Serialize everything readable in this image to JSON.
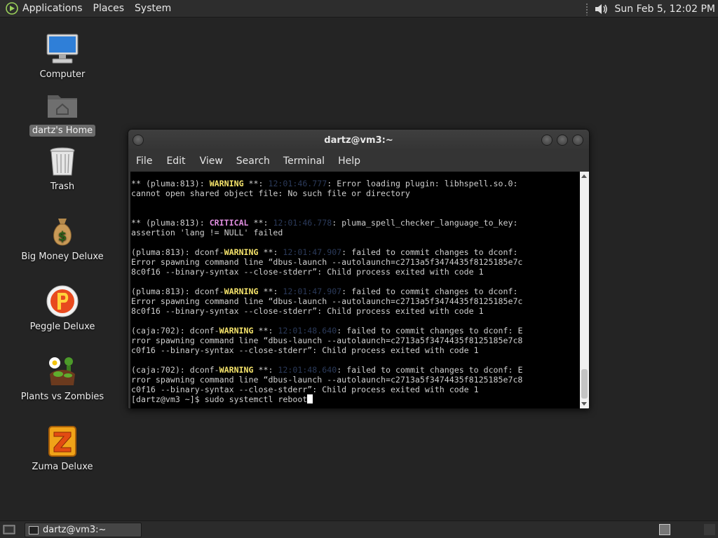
{
  "top_panel": {
    "menus": [
      "Applications",
      "Places",
      "System"
    ],
    "clock": "Sun Feb  5, 12:02 PM",
    "icons": [
      "distro-logo-icon",
      "volume-icon"
    ]
  },
  "desktop": {
    "icons": [
      {
        "label": "Computer",
        "icon": "computer-icon"
      },
      {
        "label": "dartz's Home",
        "icon": "home-folder-icon",
        "selected": true
      },
      {
        "label": "Trash",
        "icon": "trash-icon"
      },
      {
        "label": "Big Money Deluxe",
        "icon": "money-bag-icon"
      },
      {
        "label": "Peggle Deluxe",
        "icon": "peggle-icon"
      },
      {
        "label": "Plants vs Zombies",
        "icon": "plants-vs-zombies-icon"
      },
      {
        "label": "Zuma Deluxe",
        "icon": "zuma-icon"
      }
    ]
  },
  "terminal": {
    "title": "dartz@vm3:~",
    "menus": [
      "File",
      "Edit",
      "View",
      "Search",
      "Terminal",
      "Help"
    ],
    "lines": [
      {
        "segments": [
          {
            "t": "** (pluma:813): "
          },
          {
            "t": "WARNING",
            "c": "w"
          },
          {
            "t": " **: "
          },
          {
            "t": "12:01:46.777",
            "c": "t"
          },
          {
            "t": ": Error loading plugin: libhspell.so.0:"
          }
        ]
      },
      {
        "segments": [
          {
            "t": "cannot open shared object file: No such file or directory"
          }
        ]
      },
      {
        "segments": [
          {
            "t": ""
          }
        ]
      },
      {
        "segments": [
          {
            "t": ""
          }
        ]
      },
      {
        "segments": [
          {
            "t": "** (pluma:813): "
          },
          {
            "t": "CRITICAL",
            "c": "c"
          },
          {
            "t": " **: "
          },
          {
            "t": "12:01:46.778",
            "c": "t"
          },
          {
            "t": ": pluma_spell_checker_language_to_key:"
          }
        ]
      },
      {
        "segments": [
          {
            "t": "assertion 'lang != NULL' failed"
          }
        ]
      },
      {
        "segments": [
          {
            "t": ""
          }
        ]
      },
      {
        "segments": [
          {
            "t": "(pluma:813): dconf-"
          },
          {
            "t": "WARNING",
            "c": "w"
          },
          {
            "t": " **: "
          },
          {
            "t": "12:01:47.907",
            "c": "t"
          },
          {
            "t": ": failed to commit changes to dconf:"
          }
        ]
      },
      {
        "segments": [
          {
            "t": "Error spawning command line “dbus-launch --autolaunch=c2713a5f3474435f8125185e7c"
          }
        ]
      },
      {
        "segments": [
          {
            "t": "8c0f16 --binary-syntax --close-stderr”: Child process exited with code 1"
          }
        ]
      },
      {
        "segments": [
          {
            "t": ""
          }
        ]
      },
      {
        "segments": [
          {
            "t": "(pluma:813): dconf-"
          },
          {
            "t": "WARNING",
            "c": "w"
          },
          {
            "t": " **: "
          },
          {
            "t": "12:01:47.907",
            "c": "t"
          },
          {
            "t": ": failed to commit changes to dconf:"
          }
        ]
      },
      {
        "segments": [
          {
            "t": "Error spawning command line “dbus-launch --autolaunch=c2713a5f3474435f8125185e7c"
          }
        ]
      },
      {
        "segments": [
          {
            "t": "8c0f16 --binary-syntax --close-stderr”: Child process exited with code 1"
          }
        ]
      },
      {
        "segments": [
          {
            "t": ""
          }
        ]
      },
      {
        "segments": [
          {
            "t": "(caja:702): dconf-"
          },
          {
            "t": "WARNING",
            "c": "w"
          },
          {
            "t": " **: "
          },
          {
            "t": "12:01:48.640",
            "c": "t"
          },
          {
            "t": ": failed to commit changes to dconf: E"
          }
        ]
      },
      {
        "segments": [
          {
            "t": "rror spawning command line “dbus-launch --autolaunch=c2713a5f3474435f8125185e7c8"
          }
        ]
      },
      {
        "segments": [
          {
            "t": "c0f16 --binary-syntax --close-stderr”: Child process exited with code 1"
          }
        ]
      },
      {
        "segments": [
          {
            "t": ""
          }
        ]
      },
      {
        "segments": [
          {
            "t": "(caja:702): dconf-"
          },
          {
            "t": "WARNING",
            "c": "w"
          },
          {
            "t": " **: "
          },
          {
            "t": "12:01:48.640",
            "c": "t"
          },
          {
            "t": ": failed to commit changes to dconf: E"
          }
        ]
      },
      {
        "segments": [
          {
            "t": "rror spawning command line “dbus-launch --autolaunch=c2713a5f3474435f8125185e7c8"
          }
        ]
      },
      {
        "segments": [
          {
            "t": "c0f16 --binary-syntax --close-stderr”: Child process exited with code 1"
          }
        ]
      }
    ],
    "prompt": "[dartz@vm3 ~]$ ",
    "command": "sudo systemctl reboot"
  },
  "bottom_panel": {
    "task_label": "dartz@vm3:~"
  },
  "colors": {
    "warning": "#f5e36b",
    "critical": "#e08ee0",
    "timestamp": "#2b3a5a",
    "terminal_bg": "#000000",
    "desktop_bg": "#242424"
  }
}
